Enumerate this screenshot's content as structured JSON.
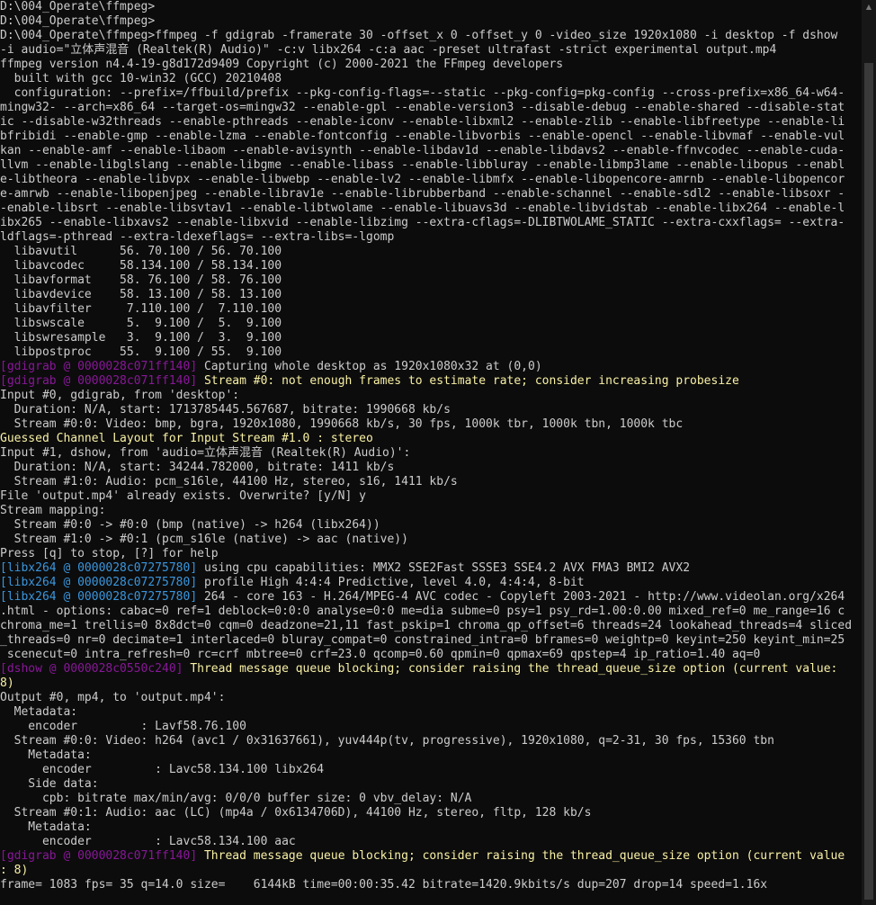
{
  "colors": {
    "foreground": "#cccccc",
    "background": "#0c0c0c",
    "gdigrab_tag": "#881798",
    "libx264_tag": "#3a96dd",
    "dshow_tag": "#881798",
    "warning_text": "#f9f1a5",
    "info_text": "#cccccc"
  },
  "lines": [
    {
      "text": "D:\\004_Operate\\ffmpeg>"
    },
    {
      "text": "D:\\004_Operate\\ffmpeg>"
    },
    {
      "text": "D:\\004_Operate\\ffmpeg>ffmpeg -f gdigrab -framerate 30 -offset_x 0 -offset_y 0 -video_size 1920x1080 -i desktop -f dshow"
    },
    {
      "text": "-i audio=\"立体声混音 (Realtek(R) Audio)\" -c:v libx264 -c:a aac -preset ultrafast -strict experimental output.mp4"
    },
    {
      "text": "ffmpeg version n4.4-19-g8d172d9409 Copyright (c) 2000-2021 the FFmpeg developers"
    },
    {
      "text": "  built with gcc 10-win32 (GCC) 20210408"
    },
    {
      "text": "  configuration: --prefix=/ffbuild/prefix --pkg-config-flags=--static --pkg-config=pkg-config --cross-prefix=x86_64-w64-"
    },
    {
      "text": "mingw32- --arch=x86_64 --target-os=mingw32 --enable-gpl --enable-version3 --disable-debug --enable-shared --disable-stat"
    },
    {
      "text": "ic --disable-w32threads --enable-pthreads --enable-iconv --enable-libxml2 --enable-zlib --enable-libfreetype --enable-li"
    },
    {
      "text": "bfribidi --enable-gmp --enable-lzma --enable-fontconfig --enable-libvorbis --enable-opencl --enable-libvmaf --enable-vul"
    },
    {
      "text": "kan --enable-amf --enable-libaom --enable-avisynth --enable-libdav1d --enable-libdavs2 --enable-ffnvcodec --enable-cuda-"
    },
    {
      "text": "llvm --enable-libglslang --enable-libgme --enable-libass --enable-libbluray --enable-libmp3lame --enable-libopus --enabl"
    },
    {
      "text": "e-libtheora --enable-libvpx --enable-libwebp --enable-lv2 --enable-libmfx --enable-libopencore-amrnb --enable-libopencor"
    },
    {
      "text": "e-amrwb --enable-libopenjpeg --enable-librav1e --enable-librubberband --enable-schannel --enable-sdl2 --enable-libsoxr -"
    },
    {
      "text": "-enable-libsrt --enable-libsvtav1 --enable-libtwolame --enable-libuavs3d --enable-libvidstab --enable-libx264 --enable-l"
    },
    {
      "text": "ibx265 --enable-libxavs2 --enable-libxvid --enable-libzimg --extra-cflags=-DLIBTWOLAME_STATIC --extra-cxxflags= --extra-"
    },
    {
      "text": "ldflags=-pthread --extra-ldexeflags= --extra-libs=-lgomp"
    },
    {
      "text": "  libavutil      56. 70.100 / 56. 70.100"
    },
    {
      "text": "  libavcodec     58.134.100 / 58.134.100"
    },
    {
      "text": "  libavformat    58. 76.100 / 58. 76.100"
    },
    {
      "text": "  libavdevice    58. 13.100 / 58. 13.100"
    },
    {
      "text": "  libavfilter     7.110.100 /  7.110.100"
    },
    {
      "text": "  libswscale      5.  9.100 /  5.  9.100"
    },
    {
      "text": "  libswresample   3.  9.100 /  3.  9.100"
    },
    {
      "text": "  libpostproc    55.  9.100 / 55.  9.100"
    },
    {
      "tag": "[gdigrab @ 0000028c071ff140]",
      "tag_color": "gdigrab_tag",
      "text": " Capturing whole desktop as 1920x1080x32 at (0,0)",
      "text_color": "info_text"
    },
    {
      "tag": "[gdigrab @ 0000028c071ff140]",
      "tag_color": "gdigrab_tag",
      "text": " Stream #0: not enough frames to estimate rate; consider increasing probesize",
      "text_color": "warning_text"
    },
    {
      "text": "Input #0, gdigrab, from 'desktop':"
    },
    {
      "text": "  Duration: N/A, start: 1713785445.567687, bitrate: 1990668 kb/s"
    },
    {
      "text": "  Stream #0:0: Video: bmp, bgra, 1920x1080, 1990668 kb/s, 30 fps, 1000k tbr, 1000k tbn, 1000k tbc"
    },
    {
      "text": "Guessed Channel Layout for Input Stream #1.0 : stereo",
      "color": "warning_text"
    },
    {
      "text": "Input #1, dshow, from 'audio=立体声混音 (Realtek(R) Audio)':"
    },
    {
      "text": "  Duration: N/A, start: 34244.782000, bitrate: 1411 kb/s"
    },
    {
      "text": "  Stream #1:0: Audio: pcm_s16le, 44100 Hz, stereo, s16, 1411 kb/s"
    },
    {
      "text": "File 'output.mp4' already exists. Overwrite? [y/N] y"
    },
    {
      "text": "Stream mapping:"
    },
    {
      "text": "  Stream #0:0 -> #0:0 (bmp (native) -> h264 (libx264))"
    },
    {
      "text": "  Stream #1:0 -> #0:1 (pcm_s16le (native) -> aac (native))"
    },
    {
      "text": "Press [q] to stop, [?] for help"
    },
    {
      "tag": "[libx264 @ 0000028c07275780]",
      "tag_color": "libx264_tag",
      "text": " using cpu capabilities: MMX2 SSE2Fast SSSE3 SSE4.2 AVX FMA3 BMI2 AVX2",
      "text_color": "info_text"
    },
    {
      "tag": "[libx264 @ 0000028c07275780]",
      "tag_color": "libx264_tag",
      "text": " profile High 4:4:4 Predictive, level 4.0, 4:4:4, 8-bit",
      "text_color": "info_text"
    },
    {
      "tag": "[libx264 @ 0000028c07275780]",
      "tag_color": "libx264_tag",
      "text": " 264 - core 163 - H.264/MPEG-4 AVC codec - Copyleft 2003-2021 - http://www.videolan.org/x264",
      "text_color": "info_text"
    },
    {
      "text": ".html - options: cabac=0 ref=1 deblock=0:0:0 analyse=0:0 me=dia subme=0 psy=1 psy_rd=1.00:0.00 mixed_ref=0 me_range=16 c"
    },
    {
      "text": "chroma_me=1 trellis=0 8x8dct=0 cqm=0 deadzone=21,11 fast_pskip=1 chroma_qp_offset=6 threads=24 lookahead_threads=4 sliced"
    },
    {
      "text": "_threads=0 nr=0 decimate=1 interlaced=0 bluray_compat=0 constrained_intra=0 bframes=0 weightp=0 keyint=250 keyint_min=25"
    },
    {
      "text": " scenecut=0 intra_refresh=0 rc=crf mbtree=0 crf=23.0 qcomp=0.60 qpmin=0 qpmax=69 qpstep=4 ip_ratio=1.40 aq=0"
    },
    {
      "tag": "[dshow @ 0000028c0550c240]",
      "tag_color": "dshow_tag",
      "text": " Thread message queue blocking; consider raising the thread_queue_size option (current value:",
      "text_color": "warning_text"
    },
    {
      "text": "8)",
      "color": "warning_text"
    },
    {
      "text": "Output #0, mp4, to 'output.mp4':"
    },
    {
      "text": "  Metadata:"
    },
    {
      "text": "    encoder         : Lavf58.76.100"
    },
    {
      "text": "  Stream #0:0: Video: h264 (avc1 / 0x31637661), yuv444p(tv, progressive), 1920x1080, q=2-31, 30 fps, 15360 tbn"
    },
    {
      "text": "    Metadata:"
    },
    {
      "text": "      encoder         : Lavc58.134.100 libx264"
    },
    {
      "text": "    Side data:"
    },
    {
      "text": "      cpb: bitrate max/min/avg: 0/0/0 buffer size: 0 vbv_delay: N/A"
    },
    {
      "text": "  Stream #0:1: Audio: aac (LC) (mp4a / 0x6134706D), 44100 Hz, stereo, fltp, 128 kb/s"
    },
    {
      "text": "    Metadata:"
    },
    {
      "text": "      encoder         : Lavc58.134.100 aac"
    },
    {
      "tag": "[gdigrab @ 0000028c071ff140]",
      "tag_color": "gdigrab_tag",
      "text": " Thread message queue blocking; consider raising the thread_queue_size option (current value",
      "text_color": "warning_text"
    },
    {
      "text": ": 8)",
      "color": "warning_text"
    },
    {
      "text": "frame= 1083 fps= 35 q=14.0 size=    6144kB time=00:00:35.42 bitrate=1420.9kbits/s dup=207 drop=14 speed=1.16x"
    }
  ],
  "scrollbar": {
    "up_arrow": "▲"
  }
}
